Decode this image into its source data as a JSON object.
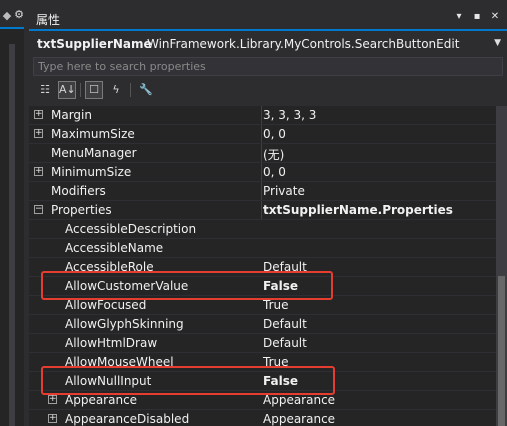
{
  "panel": {
    "title": "属性",
    "pin_icon": "▾",
    "pin": "▪",
    "close": "✕"
  },
  "left": {
    "tool": "◆",
    "gear": "⚙"
  },
  "object_selector": {
    "name": "txtSupplierName",
    "type": "WinFramework.Library.MyControls.SearchButtonEdit",
    "arrow": "▼"
  },
  "search": {
    "placeholder": "Type here to search properties"
  },
  "toolbar": {
    "categorized": "☷",
    "alphabetical": "A↓",
    "properties": "☐",
    "events": "ϟ",
    "property_pages": "🔧"
  },
  "rows": [
    {
      "name": "Margin",
      "value": "3, 3, 3, 3",
      "expander": "+",
      "level": 0
    },
    {
      "name": "MaximumSize",
      "value": "0, 0",
      "expander": "+",
      "level": 0
    },
    {
      "name": "MenuManager",
      "value": "(无)",
      "expander": "",
      "level": 0
    },
    {
      "name": "MinimumSize",
      "value": "0, 0",
      "expander": "+",
      "level": 0
    },
    {
      "name": "Modifiers",
      "value": "Private",
      "expander": "",
      "level": 0
    },
    {
      "name": "Properties",
      "value": "txtSupplierName.Properties",
      "expander": "−",
      "level": 0,
      "bold": true
    },
    {
      "name": "AccessibleDescription",
      "value": "",
      "expander": "",
      "level": 1
    },
    {
      "name": "AccessibleName",
      "value": "",
      "expander": "",
      "level": 1
    },
    {
      "name": "AccessibleRole",
      "value": "Default",
      "expander": "",
      "level": 1
    },
    {
      "name": "AllowCustomerValue",
      "value": "False",
      "expander": "",
      "level": 1,
      "bold": true
    },
    {
      "name": "AllowFocused",
      "value": "True",
      "expander": "",
      "level": 1
    },
    {
      "name": "AllowGlyphSkinning",
      "value": "Default",
      "expander": "",
      "level": 1
    },
    {
      "name": "AllowHtmlDraw",
      "value": "Default",
      "expander": "",
      "level": 1
    },
    {
      "name": "AllowMouseWheel",
      "value": "True",
      "expander": "",
      "level": 1
    },
    {
      "name": "AllowNullInput",
      "value": "False",
      "expander": "",
      "level": 1,
      "bold": true
    },
    {
      "name": "Appearance",
      "value": "Appearance",
      "expander": "+",
      "level": 1
    },
    {
      "name": "AppearanceDisabled",
      "value": "Appearance",
      "expander": "+",
      "level": 1
    }
  ],
  "colors": {
    "highlight_box": "#e53e30",
    "accent": "#007acc"
  }
}
